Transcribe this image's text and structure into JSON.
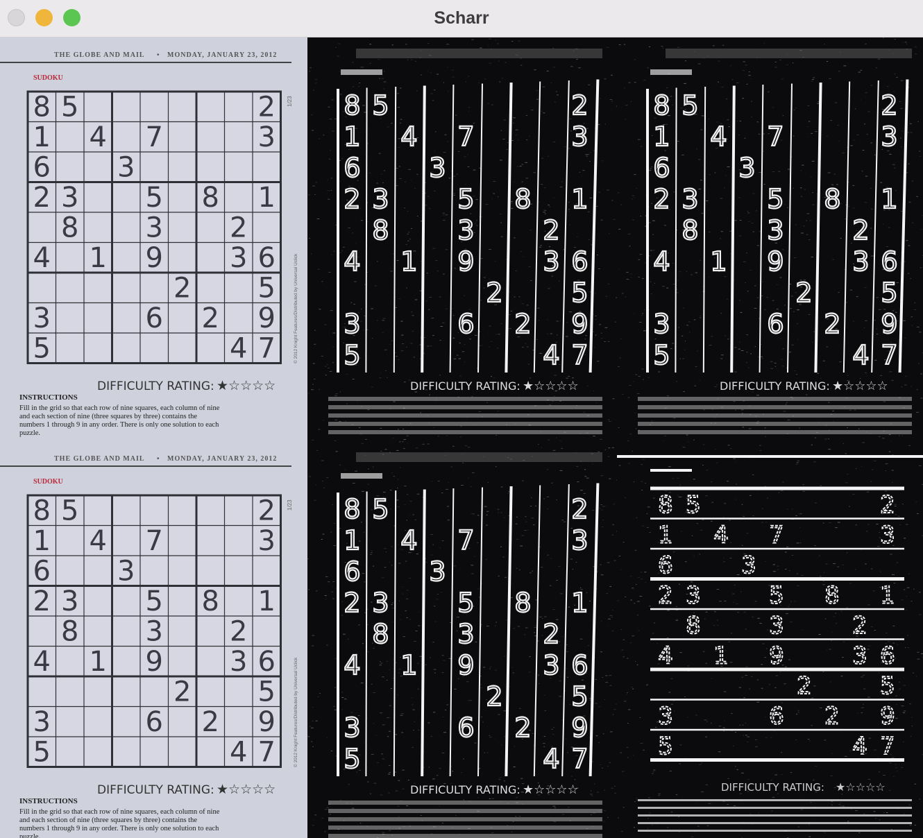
{
  "window": {
    "title": "Scharr"
  },
  "newspaper": {
    "header_left": "THE GLOBE AND MAIL",
    "header_sep": "•",
    "header_right": "MONDAY, JANUARY 23, 2012",
    "section": "SUDOKU",
    "side_code": "1/23",
    "copyright": "© 2012 Knight Features/Distributed by Universal Uclick",
    "rating_label": "DIFFICULTY RATING:",
    "rating_stars": "★☆☆☆☆",
    "instructions_title": "INSTRUCTIONS",
    "instructions_lines": [
      "Fill in the grid so that each row of nine squares, each column of nine",
      "and each section of nine (three squares by three) contains the",
      "numbers 1 through 9 in any order. There is only one solution to each",
      "puzzle."
    ]
  },
  "sudoku": [
    [
      "8",
      "5",
      "",
      "",
      "",
      "",
      "",
      "",
      "2"
    ],
    [
      "1",
      "",
      "4",
      "",
      "7",
      "",
      "",
      "",
      "3"
    ],
    [
      "6",
      "",
      "",
      "3",
      "",
      "",
      "",
      "",
      ""
    ],
    [
      "2",
      "3",
      "",
      "",
      "5",
      "",
      "8",
      "",
      "1"
    ],
    [
      "",
      "8",
      "",
      "",
      "3",
      "",
      "",
      "2",
      ""
    ],
    [
      "4",
      "",
      "1",
      "",
      "9",
      "",
      "",
      "3",
      "6"
    ],
    [
      "",
      "",
      "",
      "",
      "",
      "2",
      "",
      "",
      "5"
    ],
    [
      "3",
      "",
      "",
      "",
      "6",
      "",
      "2",
      "",
      "9"
    ],
    [
      "5",
      "",
      "",
      "",
      "",
      "",
      "",
      "4",
      "7"
    ]
  ],
  "panels": [
    {
      "name": "panel-original-top",
      "kind": "original"
    },
    {
      "name": "panel-scharr-x-top-middle",
      "kind": "scharr-x"
    },
    {
      "name": "panel-scharr-x-top-right",
      "kind": "scharr-x"
    },
    {
      "name": "panel-original-bottom",
      "kind": "original"
    },
    {
      "name": "panel-scharr-x-bottom-middle",
      "kind": "scharr-x"
    },
    {
      "name": "panel-scharr-y-bottom-right",
      "kind": "scharr-y"
    }
  ],
  "colors": {
    "close": "#d8d6d8",
    "minimize": "#f0b63c",
    "maximize": "#5cc653",
    "paper": "#cfd1dc",
    "ink": "#2f2f36",
    "section_red": "#b8283a",
    "edge": "#f4f4f4"
  }
}
